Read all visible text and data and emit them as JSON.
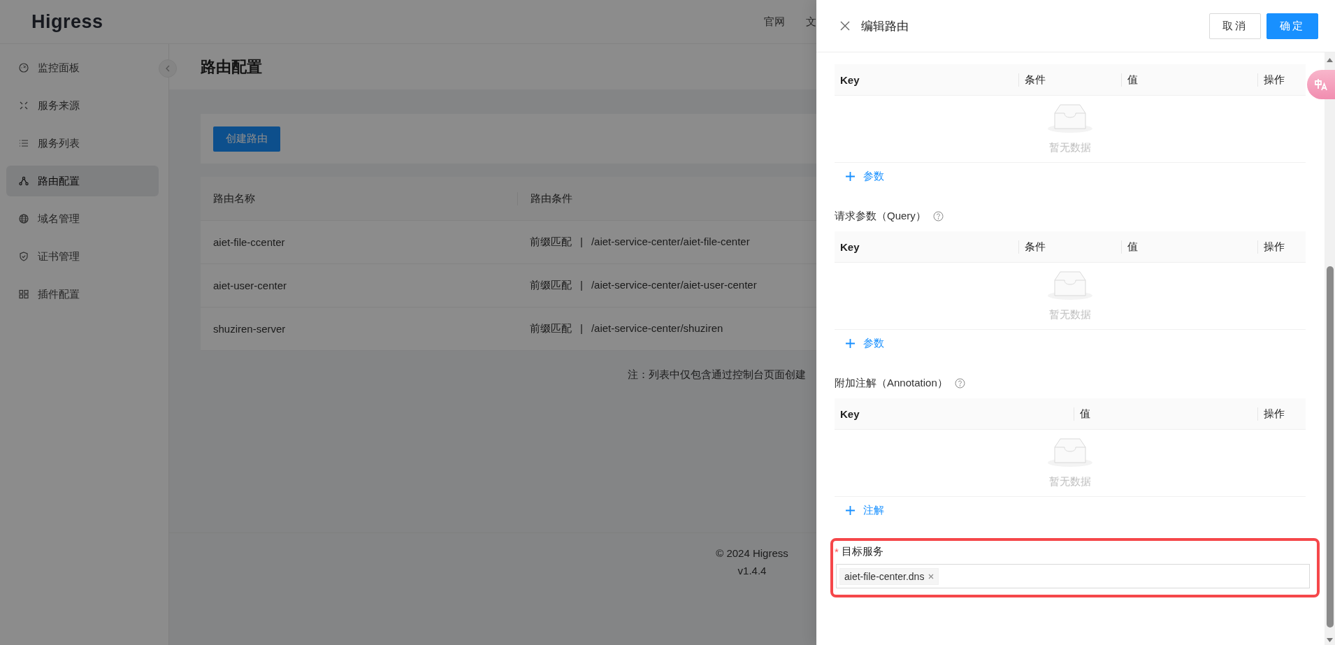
{
  "header": {
    "logo": "Higress",
    "nav": [
      "官网",
      "文"
    ]
  },
  "sidebar": {
    "items": [
      {
        "label": "监控面板",
        "selected": false
      },
      {
        "label": "服务来源",
        "selected": false
      },
      {
        "label": "服务列表",
        "selected": false
      },
      {
        "label": "路由配置",
        "selected": true
      },
      {
        "label": "域名管理",
        "selected": false
      },
      {
        "label": "证书管理",
        "selected": false
      },
      {
        "label": "插件配置",
        "selected": false
      }
    ]
  },
  "page": {
    "title": "路由配置",
    "create_button": "创建路由",
    "table": {
      "columns": [
        "路由名称",
        "路由条件"
      ],
      "rows": [
        {
          "name": "aiet-file-ccenter",
          "match_type": "前缀匹配",
          "separator": "|",
          "path": "/aiet-service-center/aiet-file-center"
        },
        {
          "name": "aiet-user-center",
          "match_type": "前缀匹配",
          "separator": "|",
          "path": "/aiet-service-center/aiet-user-center"
        },
        {
          "name": "shuziren-server",
          "match_type": "前缀匹配",
          "separator": "|",
          "path": "/aiet-service-center/shuziren"
        }
      ]
    },
    "note": "注：列表中仅包含通过控制台页面创建"
  },
  "footer": {
    "copyright": "© 2024 Higress",
    "version": "v1.4.4"
  },
  "drawer": {
    "title": "编辑路由",
    "buttons": [
      {
        "label": "取消",
        "kind": "default"
      },
      {
        "label": "确定",
        "kind": "primary"
      }
    ],
    "sections": [
      {
        "columns": [
          "Key",
          "条件",
          "值",
          "操作"
        ],
        "empty_text": "暂无数据",
        "add_label": "参数"
      },
      {
        "title": "请求参数（Query）",
        "columns": [
          "Key",
          "条件",
          "值",
          "操作"
        ],
        "empty_text": "暂无数据",
        "add_label": "参数"
      },
      {
        "title": "附加注解（Annotation）",
        "columns": [
          "Key",
          "值",
          "操作"
        ],
        "empty_text": "暂无数据",
        "add_label": "注解"
      }
    ],
    "target_service": {
      "required_mark": "*",
      "label": "目标服务",
      "highlighted": true,
      "tags": [
        "aiet-file-center.dns"
      ]
    }
  }
}
